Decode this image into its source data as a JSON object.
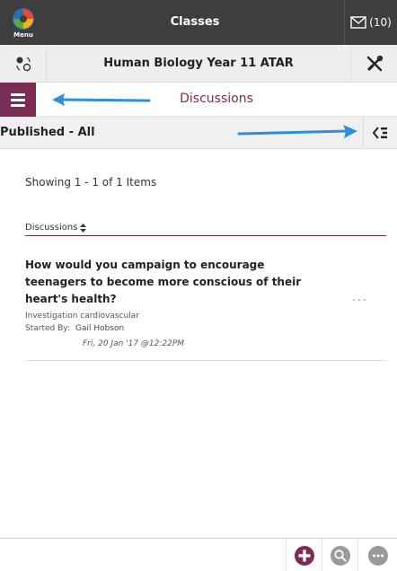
{
  "topbar": {
    "menu_label": "Menu",
    "title": "Classes",
    "mail_count": "(10)"
  },
  "course": {
    "title": "Human Biology Year 11 ATAR"
  },
  "section": {
    "title": "Discussions"
  },
  "filter": {
    "label": "Published - All"
  },
  "listing": {
    "showing": "Showing 1 - 1 of 1 Items",
    "column_header": "Discussions"
  },
  "items": [
    {
      "title": "How would you campaign to encourage teenagers to become more conscious of their heart's health?",
      "category": "Investigation cardiovascular",
      "started_by_label": "Started By:",
      "started_by": "Gail Hobson",
      "date": "Fri, 20 Jan '17 @12:22PM",
      "more": "..."
    }
  ],
  "icons": {
    "menu_logo": "app-logo-icon",
    "mail": "envelope-icon",
    "course_switch": "switch-course-icon",
    "tools": "tools-icon",
    "hamburger": "hamburger-icon",
    "filter_toggle": "filter-panel-icon",
    "sort": "sort-icon",
    "add": "plus-circle-icon",
    "search": "search-icon",
    "more": "more-icon"
  },
  "colors": {
    "brand": "#7b2c55",
    "topbar": "#3e3e3e",
    "annotation_arrow": "#2d8fe0"
  }
}
